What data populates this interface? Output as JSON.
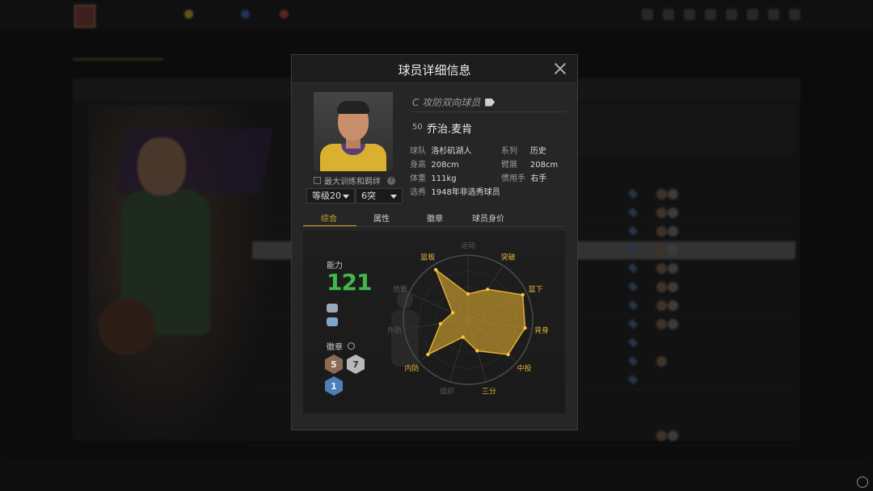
{
  "modal": {
    "title": "球员详细信息",
    "role": "C 攻防双向球员",
    "jersey_number": "50",
    "player_name": "乔治.麦肯",
    "max_training_label": "最大训练和羁绊",
    "level_dropdown": "等级20",
    "breakthrough_dropdown": "6突",
    "info": [
      {
        "key": "球队",
        "value": "洛杉矶湖人"
      },
      {
        "key": "系列",
        "value": "历史"
      },
      {
        "key": "身高",
        "value": "208cm"
      },
      {
        "key": "臂展",
        "value": "208cm"
      },
      {
        "key": "体重",
        "value": "111kg"
      },
      {
        "key": "惯用手",
        "value": "右手"
      },
      {
        "key": "选秀",
        "value": "1948年非选秀球员"
      }
    ],
    "tabs": [
      "综合",
      "属性",
      "徽章",
      "球员身价"
    ],
    "active_tab": "综合",
    "ability_label": "能力",
    "ability_value": "121",
    "ability_color": "#3fb84a",
    "accent_color": "#d7a62e",
    "badges_label": "徽章",
    "badges": [
      {
        "tier": "bronze",
        "count": "5"
      },
      {
        "tier": "silver",
        "count": "7"
      },
      {
        "tier": "blue",
        "count": "1"
      }
    ]
  },
  "chart_data": {
    "type": "radar",
    "axes": [
      "运动",
      "突破",
      "篮下",
      "背身",
      "中投",
      "三分",
      "组织",
      "内防",
      "外防",
      "抢断",
      "篮板"
    ],
    "highlighted_axes": [
      "突破",
      "篮下",
      "背身",
      "中投",
      "三分",
      "内防",
      "篮板"
    ],
    "values": [
      0.4,
      0.56,
      0.93,
      0.89,
      0.82,
      0.5,
      0.28,
      0.82,
      0.43,
      0.26,
      0.92
    ],
    "max": 1.0
  }
}
